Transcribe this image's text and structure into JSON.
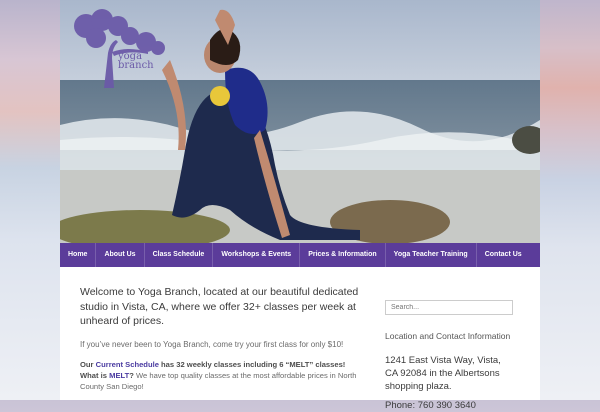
{
  "logo": {
    "text": "yoga\nbranch",
    "color": "#6b5aa8",
    "icon": "tree-icon"
  },
  "nav": {
    "items": [
      "Home",
      "About Us",
      "Class Schedule",
      "Workshops & Events",
      "Prices & Information",
      "Yoga Teacher Training",
      "Contact Us"
    ],
    "background": "#5b3c9a"
  },
  "main": {
    "intro": "Welcome to Yoga Branch, located at our beautiful dedicated studio in Vista, CA, where we offer 32+ classes per week at unheard of prices.",
    "note": "If you’ve never been to Yoga Branch, come try your first class for only $10!",
    "para": {
      "our": "Our ",
      "schedule_link": "Current Schedule",
      "has": " has 32 weekly classes including 6 “MELT” classes! What is ",
      "melt_link": "MELT",
      "q": "?",
      "rest": " We have top quality classes at the most affordable prices in North County San Diego!"
    }
  },
  "sidebar": {
    "search_placeholder": "Search...",
    "title": "Location and Contact Information",
    "address": "1241 East Vista Way, Vista, CA 92084 in the Albertsons shopping plaza.",
    "phone_partial": "Phone: 760 390 3640"
  }
}
